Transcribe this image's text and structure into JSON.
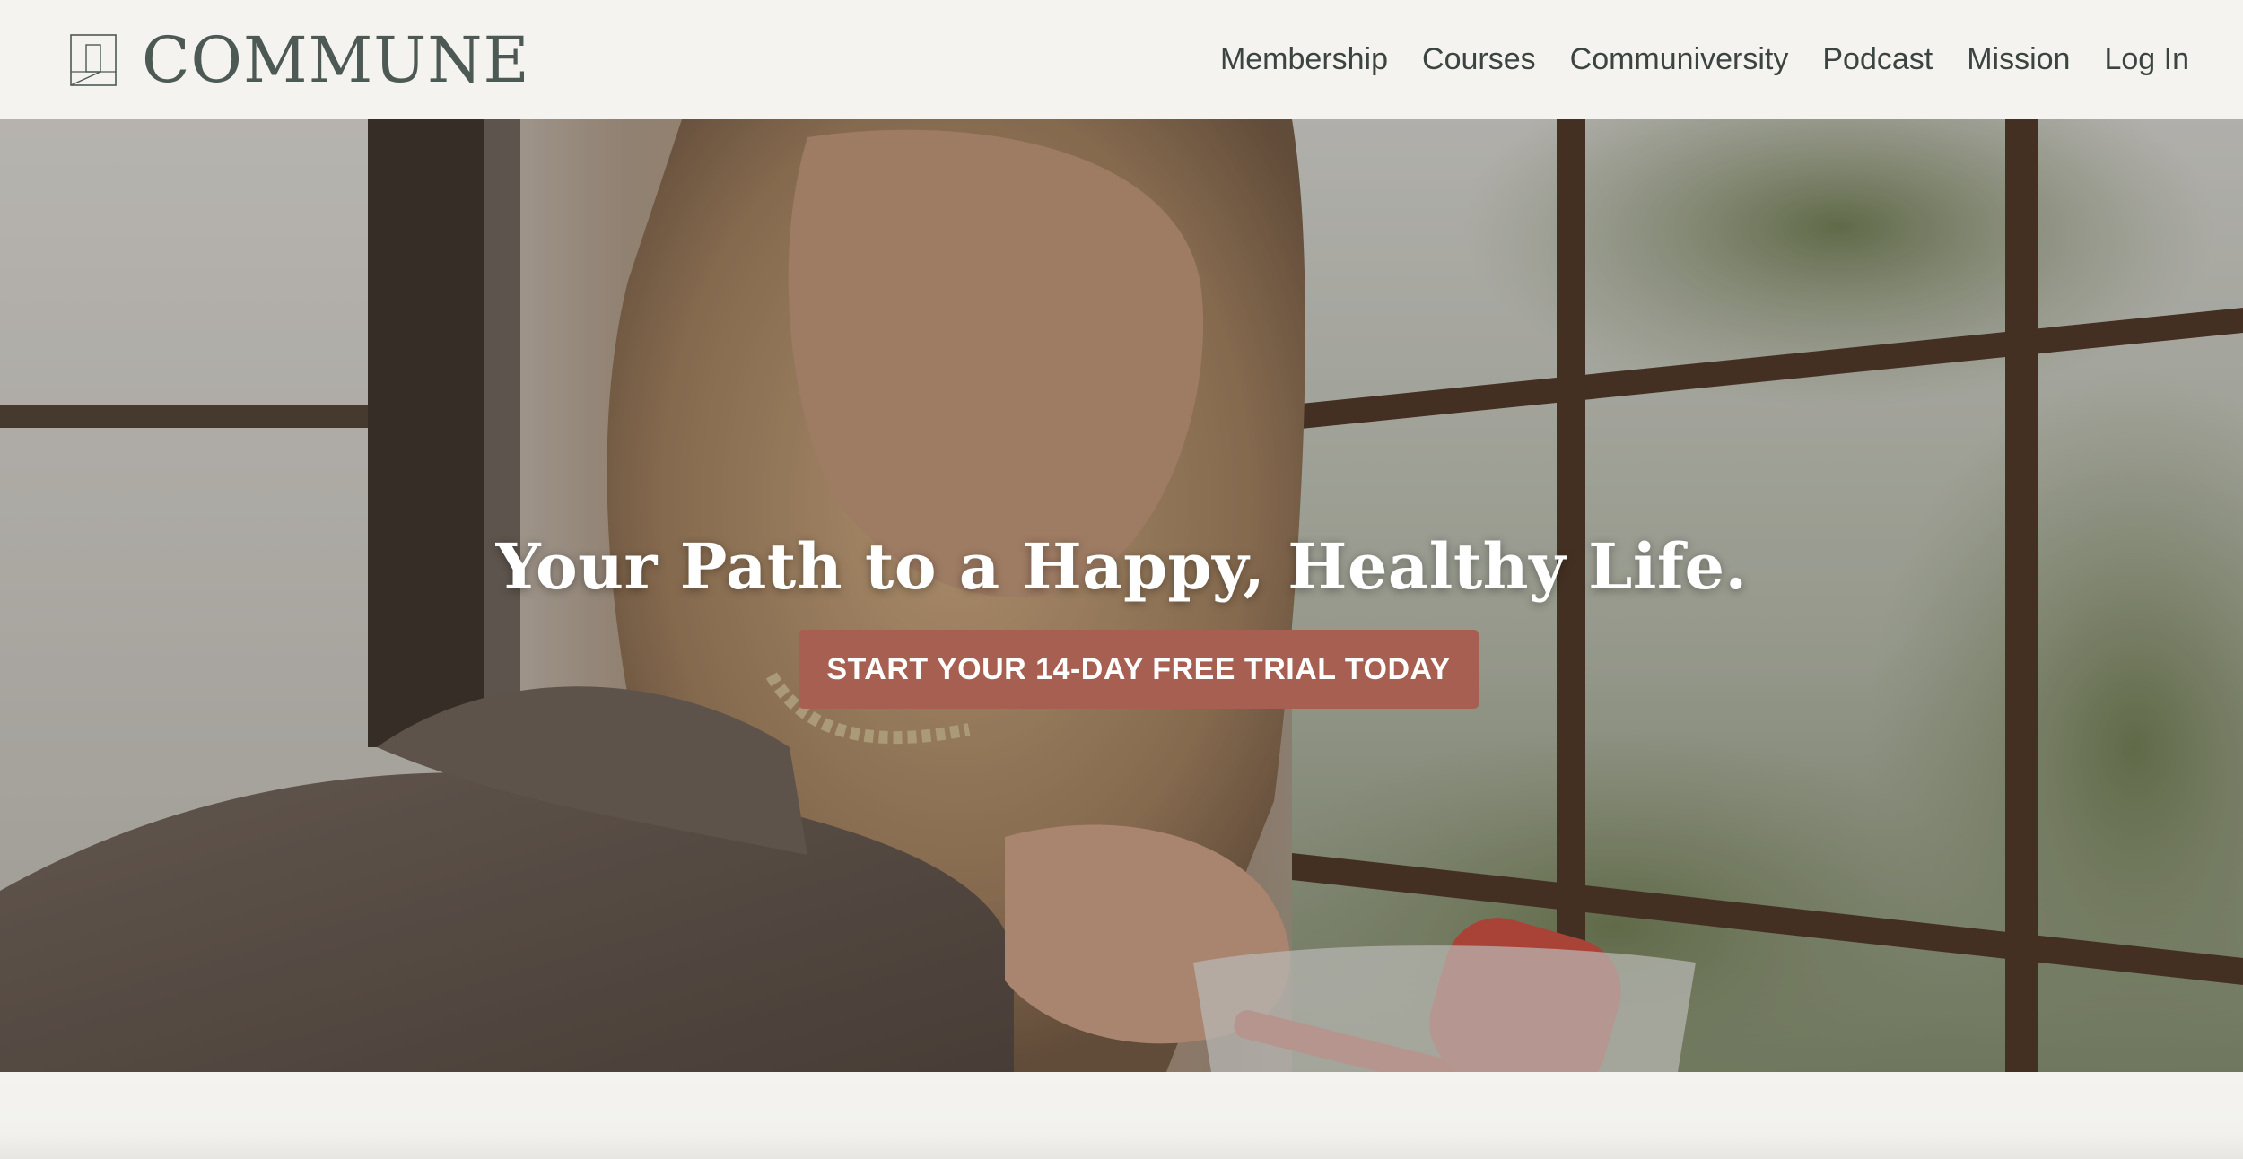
{
  "brand": {
    "name": "COMMUNE",
    "icon": "commune-logo-icon"
  },
  "nav": {
    "items": [
      {
        "label": "Membership"
      },
      {
        "label": "Courses"
      },
      {
        "label": "Communiversity"
      },
      {
        "label": "Podcast"
      },
      {
        "label": "Mission"
      },
      {
        "label": "Log In"
      }
    ]
  },
  "hero": {
    "title": "Your Path to a Happy, Healthy Life.",
    "cta_label": "START YOUR 14-DAY FREE TRIAL TODAY"
  },
  "colors": {
    "page_background": "#f4f3ef",
    "brand_text": "#4c5955",
    "nav_text": "#3c4442",
    "cta_background": "#a65f50",
    "hero_title": "#ffffff"
  }
}
